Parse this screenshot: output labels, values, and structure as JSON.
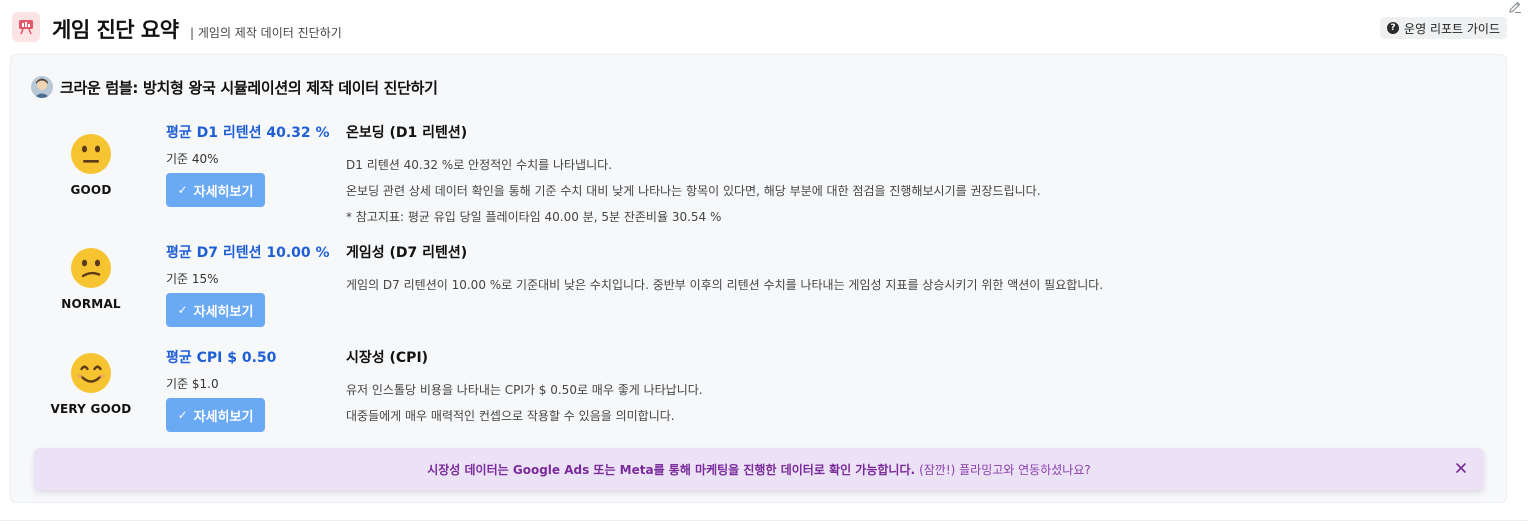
{
  "header": {
    "title": "게임 진단 요약",
    "subtitle": "| 게임의 제작 데이터 진단하기",
    "guide_button": "운영 리포트 가이드",
    "guide_icon": "question-circle-icon"
  },
  "card": {
    "title": "크라운 럼블: 방치형 왕국 시뮬레이션의 제작 데이터 진단하기",
    "rows": [
      {
        "mood": "GOOD",
        "face_icon": "neutral-face-icon",
        "metric_title": "평균 D1 리텐션 40.32 %",
        "metric_base": "기준 40%",
        "button": "자세히보기",
        "desc_title": "온보딩 (D1 리텐션)",
        "desc_lines": [
          "D1 리텐션 40.32 %로 안정적인 수치를 나타냅니다.",
          "온보딩 관련 상세 데이터 확인을 통해 기준 수치 대비 낮게 나타나는 항목이 있다면, 해당 부분에 대한 점검을 진행해보시기를 권장드립니다.",
          "* 참고지표: 평균 유입 당일 플레이타임 40.00 분, 5분 잔존비율 30.54 %"
        ]
      },
      {
        "mood": "NORMAL",
        "face_icon": "confused-face-icon",
        "metric_title": "평균 D7 리텐션 10.00 %",
        "metric_base": "기준 15%",
        "button": "자세히보기",
        "desc_title": "게임성 (D7 리텐션)",
        "desc_lines": [
          "게임의 D7 리텐션이 10.00 %로 기준대비 낮은 수치입니다. 중반부 이후의 리텐션 수치를 나타내는 게임성 지표를 상승시키기 위한 액션이 필요합니다."
        ]
      },
      {
        "mood": "VERY GOOD",
        "face_icon": "smiling-face-icon",
        "metric_title": "평균 CPI $ 0.50",
        "metric_base": "기준 $1.0",
        "button": "자세히보기",
        "desc_title": "시장성 (CPI)",
        "desc_lines": [
          "유저 인스톨당 비용을 나타내는 CPI가 $ 0.50로 매우 좋게 나타납니다.",
          "대중들에게 매우 매력적인 컨셉으로 작용할 수 있음을 의미합니다."
        ]
      }
    ]
  },
  "banner": {
    "text": "시장성 데이터는 Google Ads 또는 Meta를 통해 마케팅을 진행한 데이터로 확인 가능합니다.",
    "link": "(잠깐!) 플라밍고와 연동하셨나요?"
  },
  "colors": {
    "accent_blue": "#1f5fd6",
    "button_blue": "#6aaaf5",
    "banner_bg": "#ebe2f6",
    "banner_text": "#7a2a9a",
    "emoji_yellow": "#f7c431"
  }
}
